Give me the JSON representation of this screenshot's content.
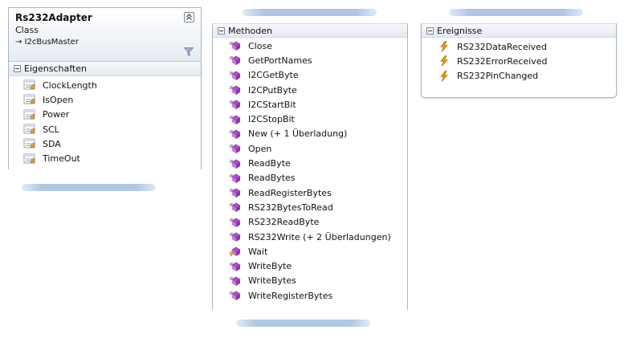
{
  "class_box": {
    "name": "Rs232Adapter",
    "kind": "Class",
    "base": "I2cBusMaster",
    "properties_section": {
      "label": "Eigenschaften",
      "items": [
        {
          "label": "ClockLength",
          "icon": "property-icon"
        },
        {
          "label": "IsOpen",
          "icon": "property-icon"
        },
        {
          "label": "Power",
          "icon": "property-icon"
        },
        {
          "label": "SCL",
          "icon": "property-icon"
        },
        {
          "label": "SDA",
          "icon": "property-icon"
        },
        {
          "label": "TimeOut",
          "icon": "property-icon"
        }
      ]
    }
  },
  "methods_box": {
    "label": "Methoden",
    "items": [
      {
        "label": "Close",
        "icon": "method-icon"
      },
      {
        "label": "GetPortNames",
        "icon": "method-icon"
      },
      {
        "label": "I2CGetByte",
        "icon": "method-icon"
      },
      {
        "label": "I2CPutByte",
        "icon": "method-icon"
      },
      {
        "label": "I2CStartBit",
        "icon": "method-icon"
      },
      {
        "label": "I2CStopBit",
        "icon": "method-icon"
      },
      {
        "label": "New (+ 1 Überladung)",
        "icon": "method-icon"
      },
      {
        "label": "Open",
        "icon": "method-icon"
      },
      {
        "label": "ReadByte",
        "icon": "method-icon"
      },
      {
        "label": "ReadBytes",
        "icon": "method-icon"
      },
      {
        "label": "ReadRegisterBytes",
        "icon": "method-icon"
      },
      {
        "label": "RS232BytesToRead",
        "icon": "method-icon"
      },
      {
        "label": "RS232ReadByte",
        "icon": "method-icon"
      },
      {
        "label": "RS232Write (+ 2 Überladungen)",
        "icon": "method-icon"
      },
      {
        "label": "Wait",
        "icon": "protected-method-icon"
      },
      {
        "label": "WriteByte",
        "icon": "method-icon"
      },
      {
        "label": "WriteBytes",
        "icon": "method-icon"
      },
      {
        "label": "WriteRegisterBytes",
        "icon": "method-icon"
      }
    ]
  },
  "events_box": {
    "label": "Ereignisse",
    "items": [
      {
        "label": "RS232DataReceived",
        "icon": "event-icon"
      },
      {
        "label": "RS232ErrorReceived",
        "icon": "event-icon"
      },
      {
        "label": "RS232PinChanged",
        "icon": "event-icon"
      }
    ]
  },
  "colors": {
    "border": "#a9b4c2",
    "method": "#b04fc9",
    "event": "#f0a000",
    "property": "#d9a43a"
  }
}
